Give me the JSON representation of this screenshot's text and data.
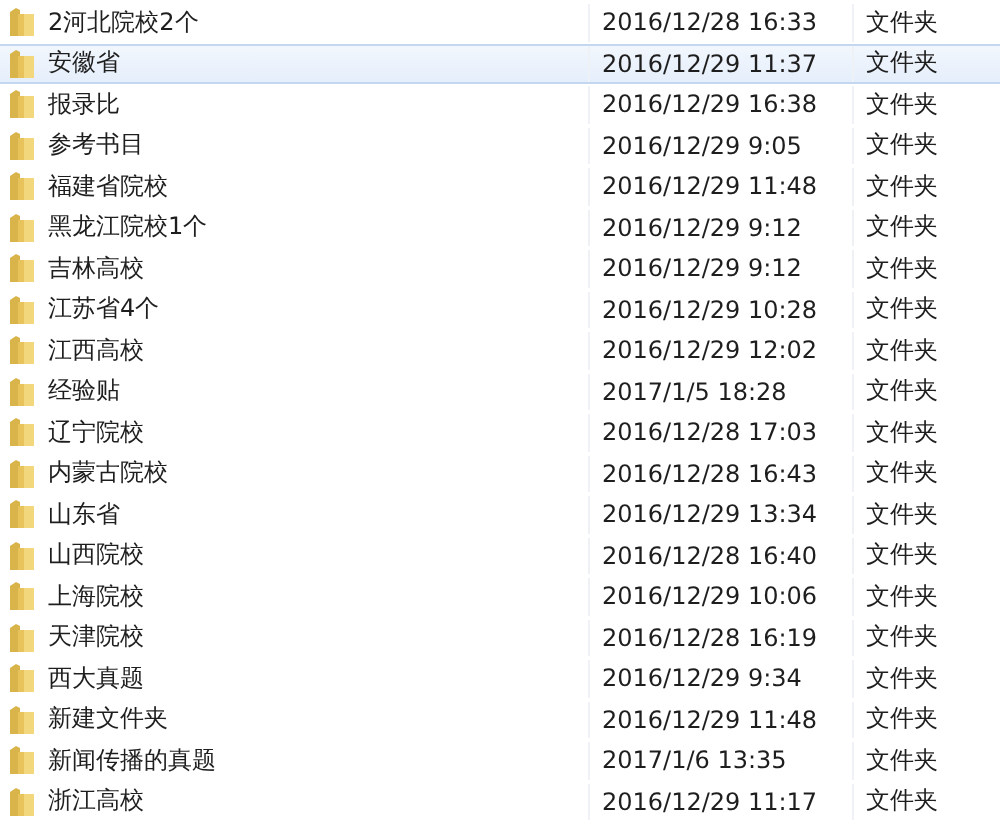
{
  "rows": [
    {
      "name": "2河北院校2个",
      "modified": "2016/12/28 16:33",
      "type": "文件夹",
      "selected": false
    },
    {
      "name": "安徽省",
      "modified": "2016/12/29 11:37",
      "type": "文件夹",
      "selected": true
    },
    {
      "name": "报录比",
      "modified": "2016/12/29 16:38",
      "type": "文件夹",
      "selected": false
    },
    {
      "name": "参考书目",
      "modified": "2016/12/29 9:05",
      "type": "文件夹",
      "selected": false
    },
    {
      "name": "福建省院校",
      "modified": "2016/12/29 11:48",
      "type": "文件夹",
      "selected": false
    },
    {
      "name": "黑龙江院校1个",
      "modified": "2016/12/29 9:12",
      "type": "文件夹",
      "selected": false
    },
    {
      "name": "吉林高校",
      "modified": "2016/12/29 9:12",
      "type": "文件夹",
      "selected": false
    },
    {
      "name": "江苏省4个",
      "modified": "2016/12/29 10:28",
      "type": "文件夹",
      "selected": false
    },
    {
      "name": "江西高校",
      "modified": "2016/12/29 12:02",
      "type": "文件夹",
      "selected": false
    },
    {
      "name": "经验贴",
      "modified": "2017/1/5 18:28",
      "type": "文件夹",
      "selected": false
    },
    {
      "name": "辽宁院校",
      "modified": "2016/12/28 17:03",
      "type": "文件夹",
      "selected": false
    },
    {
      "name": "内蒙古院校",
      "modified": "2016/12/28 16:43",
      "type": "文件夹",
      "selected": false
    },
    {
      "name": "山东省",
      "modified": "2016/12/29 13:34",
      "type": "文件夹",
      "selected": false
    },
    {
      "name": "山西院校",
      "modified": "2016/12/28 16:40",
      "type": "文件夹",
      "selected": false
    },
    {
      "name": "上海院校",
      "modified": "2016/12/29 10:06",
      "type": "文件夹",
      "selected": false
    },
    {
      "name": "天津院校",
      "modified": "2016/12/28 16:19",
      "type": "文件夹",
      "selected": false
    },
    {
      "name": "西大真题",
      "modified": "2016/12/29 9:34",
      "type": "文件夹",
      "selected": false
    },
    {
      "name": "新建文件夹",
      "modified": "2016/12/29 11:48",
      "type": "文件夹",
      "selected": false
    },
    {
      "name": "新闻传播的真题",
      "modified": "2017/1/6 13:35",
      "type": "文件夹",
      "selected": false
    },
    {
      "name": "浙江高校",
      "modified": "2016/12/29 11:17",
      "type": "文件夹",
      "selected": false
    }
  ]
}
